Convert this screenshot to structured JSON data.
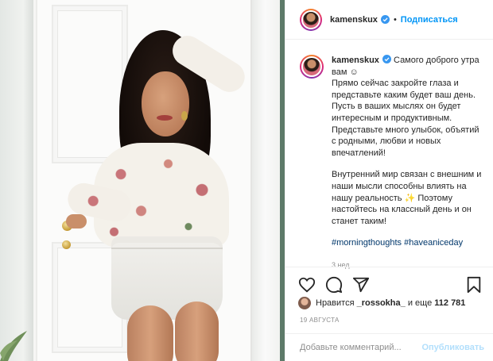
{
  "post": {
    "username": "kamenskux",
    "follow_label": "Подписаться",
    "separator": "•"
  },
  "caption": {
    "username": "kamenskux",
    "first_line": "Самого доброго утра вам ☺",
    "paragraph1": "Прямо сейчас закройте глаза и представьте каким будет ваш день. Пусть в ваших мыслях он будет интересным и продуктивным. Представьте много улыбок, объятий с родными, любви и новых впечатлений!",
    "paragraph2": "Внутренний мир связан с внешним и наши мысли способны влиять на нашу реальность ✨ Поэтому настойтесь на классный день и он станет таким!",
    "hashtags": "#morningthoughts #haveaniceday",
    "time_ago": "3 нед."
  },
  "likes": {
    "prefix": "Нравится",
    "user": "_rossokha_",
    "middle": "и еще",
    "count": "112 781"
  },
  "date": "19 АВГУСТА",
  "comment": {
    "placeholder": "Добавьте комментарий...",
    "publish_label": "Опубликовать"
  },
  "icons": {
    "like": "heart-icon",
    "comment": "comment-icon",
    "share": "share-icon",
    "save": "bookmark-icon",
    "verified": "verified-badge-icon"
  },
  "colors": {
    "accent": "#0095f6",
    "verified": "#3897f0",
    "hashtag": "#00376b",
    "muted": "#8e8e8e",
    "publish_disabled": "#b2dffc"
  }
}
